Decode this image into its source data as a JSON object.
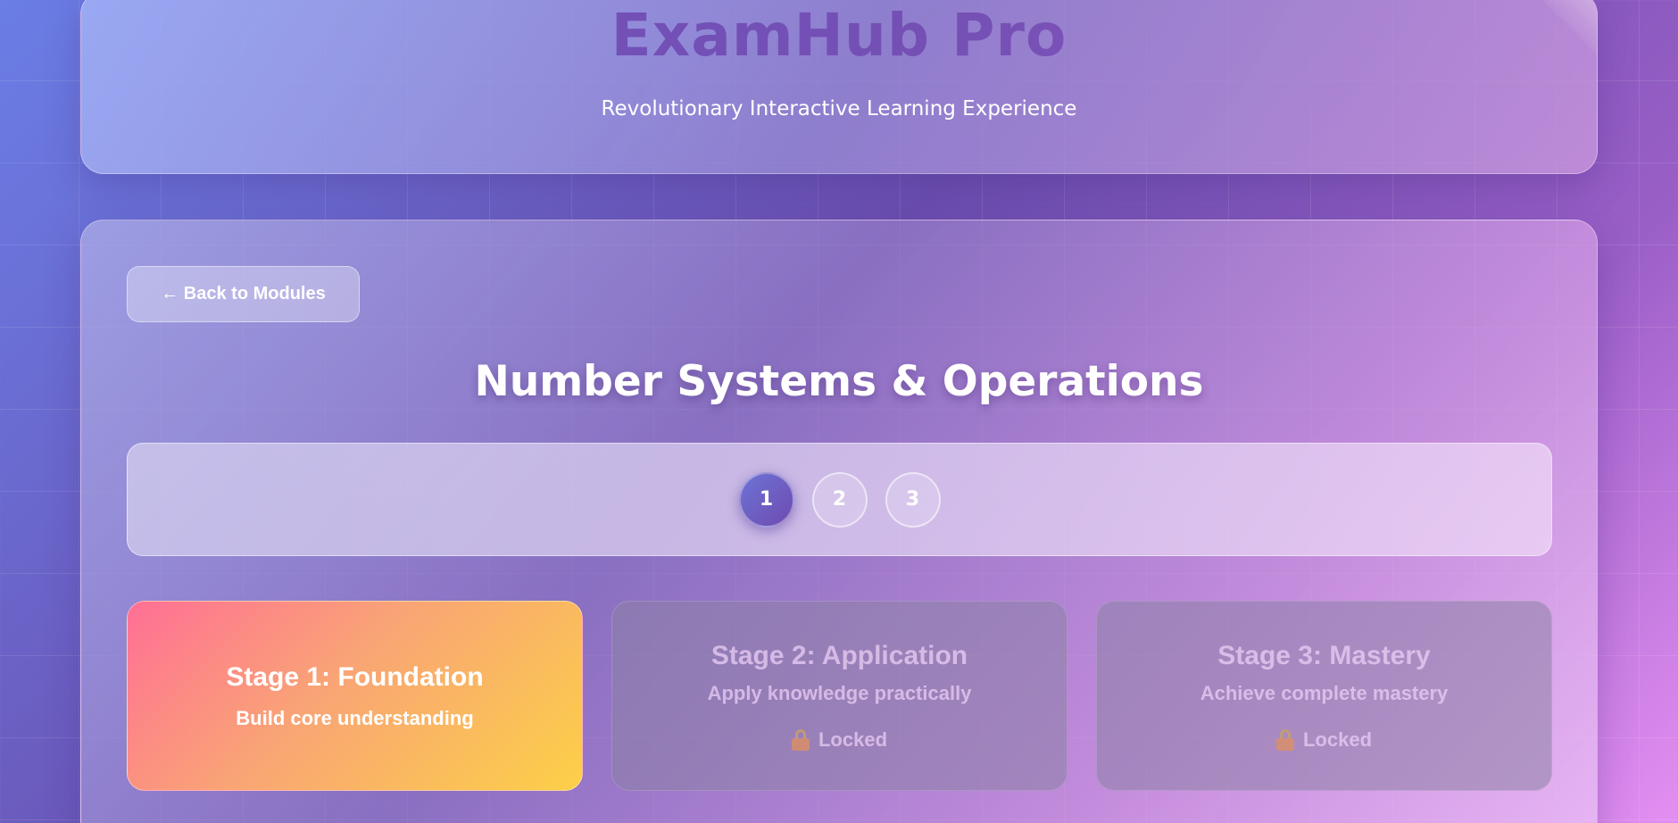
{
  "header": {
    "title": "ExamHub Pro",
    "subtitle": "Revolutionary Interactive Learning Experience"
  },
  "navigation": {
    "back_label": "← Back to Modules"
  },
  "module": {
    "title": "Number Systems & Operations"
  },
  "stepper": {
    "steps": [
      "1",
      "2",
      "3"
    ],
    "active_step": "1"
  },
  "stages": [
    {
      "title": "Stage 1: Foundation",
      "description": "Build core understanding",
      "status": "unlocked"
    },
    {
      "title": "Stage 2: Application",
      "description": "Apply knowledge practically",
      "status": "locked",
      "status_label": "Locked",
      "icon": "lock-icon"
    },
    {
      "title": "Stage 3: Mastery",
      "description": "Achieve complete mastery",
      "status": "locked",
      "status_label": "Locked",
      "icon": "lock-icon"
    }
  ],
  "colors": {
    "active_step": "#6e4bb0",
    "stage1_gradient_start": "#ff6f95",
    "stage1_gradient_end": "#fcd047"
  }
}
